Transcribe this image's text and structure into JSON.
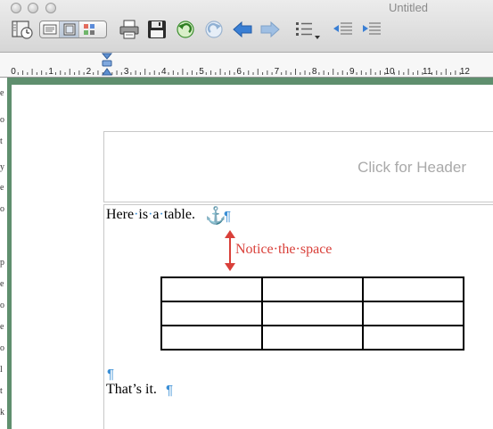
{
  "window": {
    "title": "Untitled"
  },
  "toolbar": {
    "buttons": [
      {
        "name": "sidebar-button",
        "icon": "sidebar-clock-icon"
      },
      {
        "name": "view-draft-button",
        "icon": "draft-view-icon"
      },
      {
        "name": "view-page-button",
        "icon": "page-view-icon"
      },
      {
        "name": "view-thumbnails-button",
        "icon": "thumbnails-icon"
      },
      {
        "name": "print-button",
        "icon": "printer-icon"
      },
      {
        "name": "save-button",
        "icon": "floppy-disk-icon"
      },
      {
        "name": "undo-button",
        "icon": "undo-icon"
      },
      {
        "name": "redo-button",
        "icon": "redo-icon"
      },
      {
        "name": "back-button",
        "icon": "arrow-left-icon"
      },
      {
        "name": "forward-button",
        "icon": "arrow-right-icon"
      },
      {
        "name": "list-style-button",
        "icon": "bulleted-list-icon"
      },
      {
        "name": "indent-decrease-button",
        "icon": "outdent-icon"
      },
      {
        "name": "indent-increase-button",
        "icon": "indent-icon"
      }
    ]
  },
  "ruler": {
    "numbers": [
      "0",
      "1",
      "2",
      "3",
      "4",
      "5",
      "6",
      "7",
      "8",
      "9",
      "10",
      "11",
      "12"
    ]
  },
  "left_strip": {
    "letters": [
      "e",
      "o",
      "t",
      "y",
      "e",
      "o",
      "",
      "",
      "p",
      "e",
      "o",
      "e",
      "o",
      "l",
      "t",
      "k"
    ]
  },
  "document": {
    "header_placeholder": "Click for Header",
    "line1_words": [
      "Here",
      "is",
      "a",
      "table."
    ],
    "anchor_glyph": "⚓",
    "pilcrow": "¶",
    "annotation_words": [
      "Notice",
      "the",
      "space"
    ],
    "annotation_color": "#d9403a",
    "table": {
      "rows": 3,
      "cols": 3,
      "cells": [
        [
          "",
          "",
          ""
        ],
        [
          "",
          "",
          ""
        ],
        [
          "",
          "",
          ""
        ]
      ]
    },
    "last_line": "That’s it.",
    "mark_color": "#3b8fd6"
  }
}
